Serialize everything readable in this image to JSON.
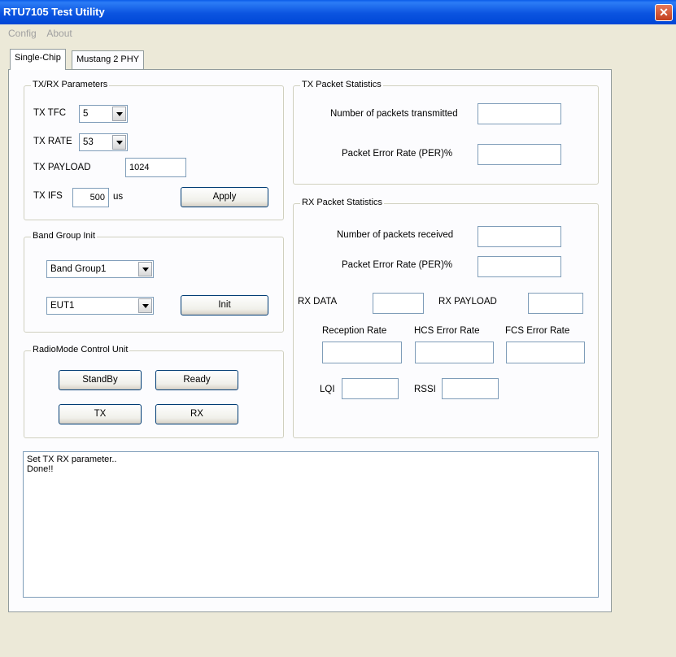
{
  "window": {
    "title": "RTU7105 Test Utility",
    "close_label": "✕"
  },
  "menu": {
    "items": [
      "Config",
      "About"
    ]
  },
  "tabs": [
    {
      "label": "Single-Chip",
      "active": true
    },
    {
      "label": "Mustang 2 PHY",
      "active": false
    }
  ],
  "txrx": {
    "title": "TX/RX Parameters",
    "tfc_label": "TX TFC",
    "tfc_value": "5",
    "rate_label": "TX RATE",
    "rate_value": "53",
    "payload_label": "TX PAYLOAD",
    "payload_value": "1024",
    "ifs_label": "TX IFS",
    "ifs_value": "500",
    "ifs_unit": "us",
    "apply_label": "Apply"
  },
  "band": {
    "title": "Band Group Init",
    "group_value": "Band Group1",
    "eut_value": "EUT1",
    "init_label": "Init"
  },
  "radio": {
    "title": "RadioMode Control Unit",
    "standby_label": "StandBy",
    "ready_label": "Ready",
    "tx_label": "TX",
    "rx_label": "RX"
  },
  "tx_stats": {
    "title": "TX Packet Statistics",
    "transmitted_label": "Number of packets transmitted",
    "transmitted_value": "",
    "per_label": "Packet Error Rate (PER)%",
    "per_value": ""
  },
  "rx_stats": {
    "title": "RX Packet Statistics",
    "received_label": "Number of packets received",
    "received_value": "",
    "per_label": "Packet Error Rate (PER)%",
    "per_value": "",
    "rx_data_label": "RX DATA",
    "rx_data_value": "",
    "rx_payload_label": "RX PAYLOAD",
    "rx_payload_value": "",
    "reception_rate_label": "Reception Rate",
    "hcs_label": "HCS Error Rate",
    "fcs_label": "FCS Error Rate",
    "lqi_label": "LQI",
    "rssi_label": "RSSI"
  },
  "log": {
    "lines": [
      "Set TX RX parameter..",
      "Done!!"
    ]
  }
}
